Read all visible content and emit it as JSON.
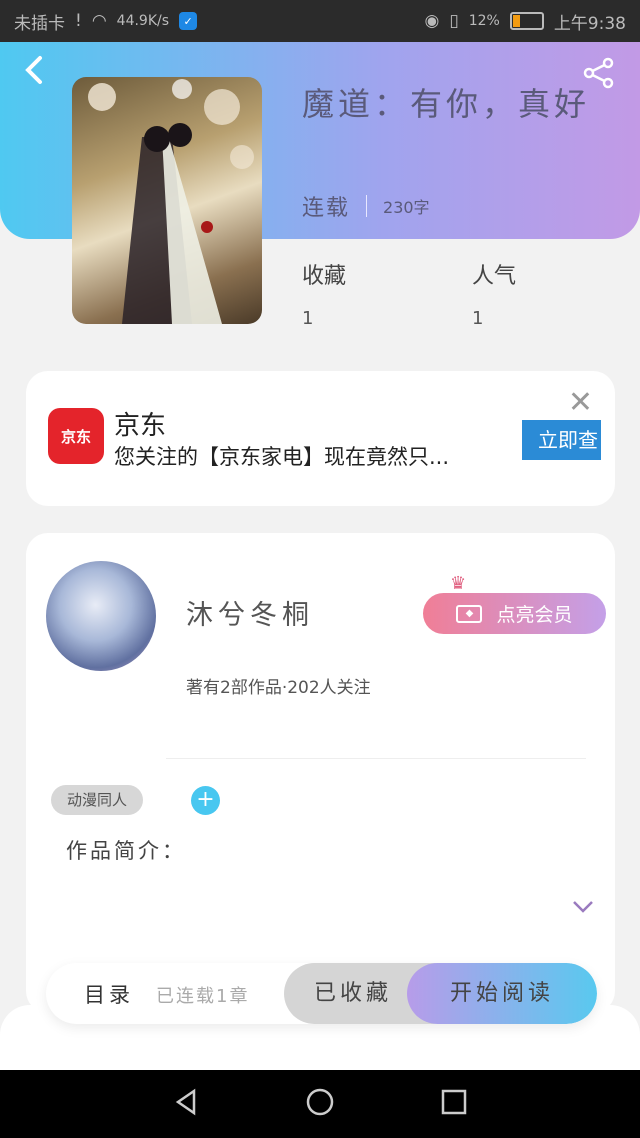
{
  "status_bar": {
    "carrier": "未插卡",
    "speed": "44.9K/s",
    "battery": "12%",
    "time": "上午9:38"
  },
  "book": {
    "title": "魔道：有你，真好",
    "status": "连载",
    "word_count": "230字",
    "stats": [
      {
        "label": "收藏",
        "value": "1"
      },
      {
        "label": "人气",
        "value": "1"
      }
    ]
  },
  "ad": {
    "logo_text": "京东",
    "title": "京东",
    "description": "您关注的【京东家电】现在竟然只...",
    "cta": "立即查"
  },
  "author": {
    "name": "沐兮冬桐",
    "stats": "著有2部作品·202人关注",
    "vip_label": "点亮会员",
    "tag": "动漫同人",
    "intro_label": "作品简介："
  },
  "actions": {
    "toc_label": "目录",
    "chapters": "已连载1章",
    "favorite_label": "已收藏",
    "read_label": "开始阅读"
  },
  "icons": {
    "back": "chevron-left-icon",
    "share": "share-icon",
    "close": "close-icon",
    "add": "plus-icon",
    "expand": "chevron-down-icon"
  },
  "colors": {
    "header_gradient_start": "#4fc9f1",
    "header_gradient_end": "#c29ae6",
    "vip_gradient_start": "#f07e96",
    "vip_gradient_end": "#c4a0e8",
    "accent_blue": "#48c7f0",
    "ad_red": "#e4242b"
  }
}
